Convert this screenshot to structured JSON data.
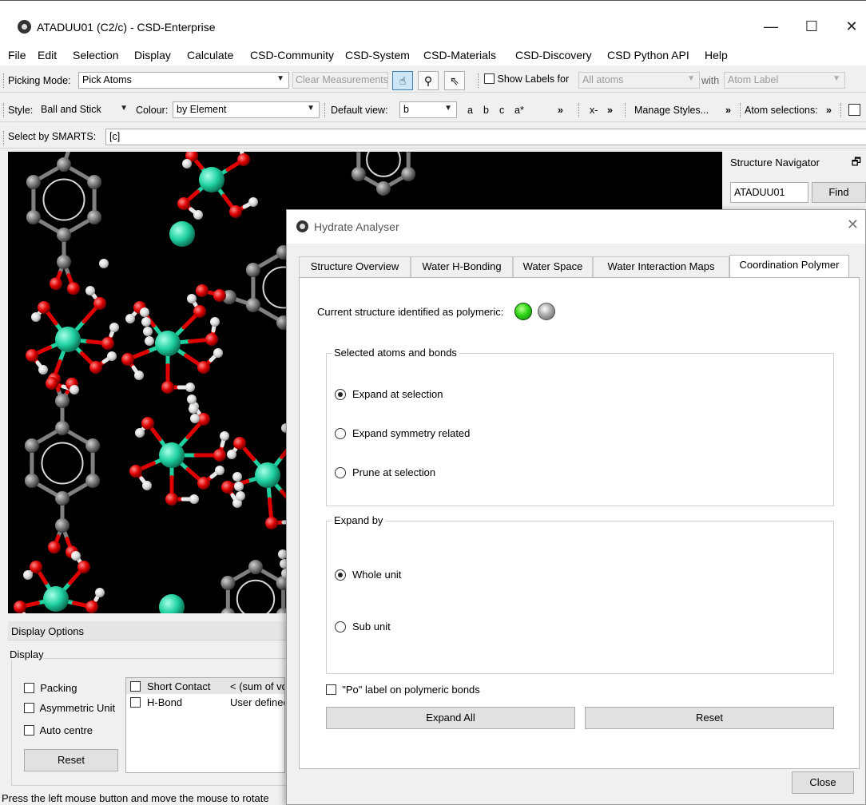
{
  "window": {
    "title": "ATADUU01 (C2/c) - CSD-Enterprise"
  },
  "menu": [
    "File",
    "Edit",
    "Selection",
    "Display",
    "Calculate",
    "CSD-Community",
    "CSD-System",
    "CSD-Materials",
    "CSD-Discovery",
    "CSD Python API",
    "Help"
  ],
  "toolbar1": {
    "picking_label": "Picking Mode:",
    "picking_value": "Pick Atoms",
    "clear_measurements": "Clear Measurements",
    "show_labels": "Show Labels for",
    "labels_target": "All atoms",
    "with_label": "with",
    "label_type": "Atom Label"
  },
  "toolbar2": {
    "style_label": "Style:",
    "style_value": "Ball and Stick",
    "colour_label": "Colour:",
    "colour_value": "by Element",
    "default_view_label": "Default view:",
    "default_view_value": "b",
    "axes": [
      "a",
      "b",
      "c",
      "a*"
    ],
    "more": "»",
    "x_minus": "x-",
    "manage_styles": "Manage Styles...",
    "atom_selections": "Atom selections:"
  },
  "toolbar3": {
    "smarts_label": "Select by SMARTS:",
    "smarts_value": "[c]"
  },
  "navigator": {
    "title": "Structure Navigator",
    "refcode": "ATADUU01",
    "find": "Find"
  },
  "display_options": {
    "title": "Display Options",
    "group": "Display",
    "packing": "Packing",
    "asymmetric_unit": "Asymmetric Unit",
    "auto_centre": "Auto centre",
    "reset": "Reset",
    "contacts": [
      {
        "name": "Short Contact",
        "desc": "< (sum of vdW radii)"
      },
      {
        "name": "H-Bond",
        "desc": "User defined"
      }
    ]
  },
  "status": "Press the left mouse button and move the mouse to rotate",
  "dialog": {
    "title": "Hydrate Analyser",
    "tabs": [
      "Structure Overview",
      "Water H-Bonding",
      "Water Space",
      "Water Interaction Maps",
      "Coordination Polymer"
    ],
    "active_tab": "Coordination Polymer",
    "polymeric_label": "Current structure identified as polymeric:",
    "selected_group": "Selected atoms and bonds",
    "selected_options": [
      "Expand at selection",
      "Expand symmetry related",
      "Prune at selection"
    ],
    "selected_checked": 0,
    "expand_group": "Expand by",
    "expand_options": [
      "Whole unit",
      "Sub unit"
    ],
    "expand_checked": 0,
    "po_label": "\"Po\" label on polymeric bonds",
    "expand_all": "Expand All",
    "reset": "Reset",
    "close": "Close"
  },
  "colors": {
    "carbon": "#808080",
    "oxygen": "#e00000",
    "hydrogen": "#e8e8e8",
    "metal": "#1fd1a0",
    "background": "#000000"
  }
}
